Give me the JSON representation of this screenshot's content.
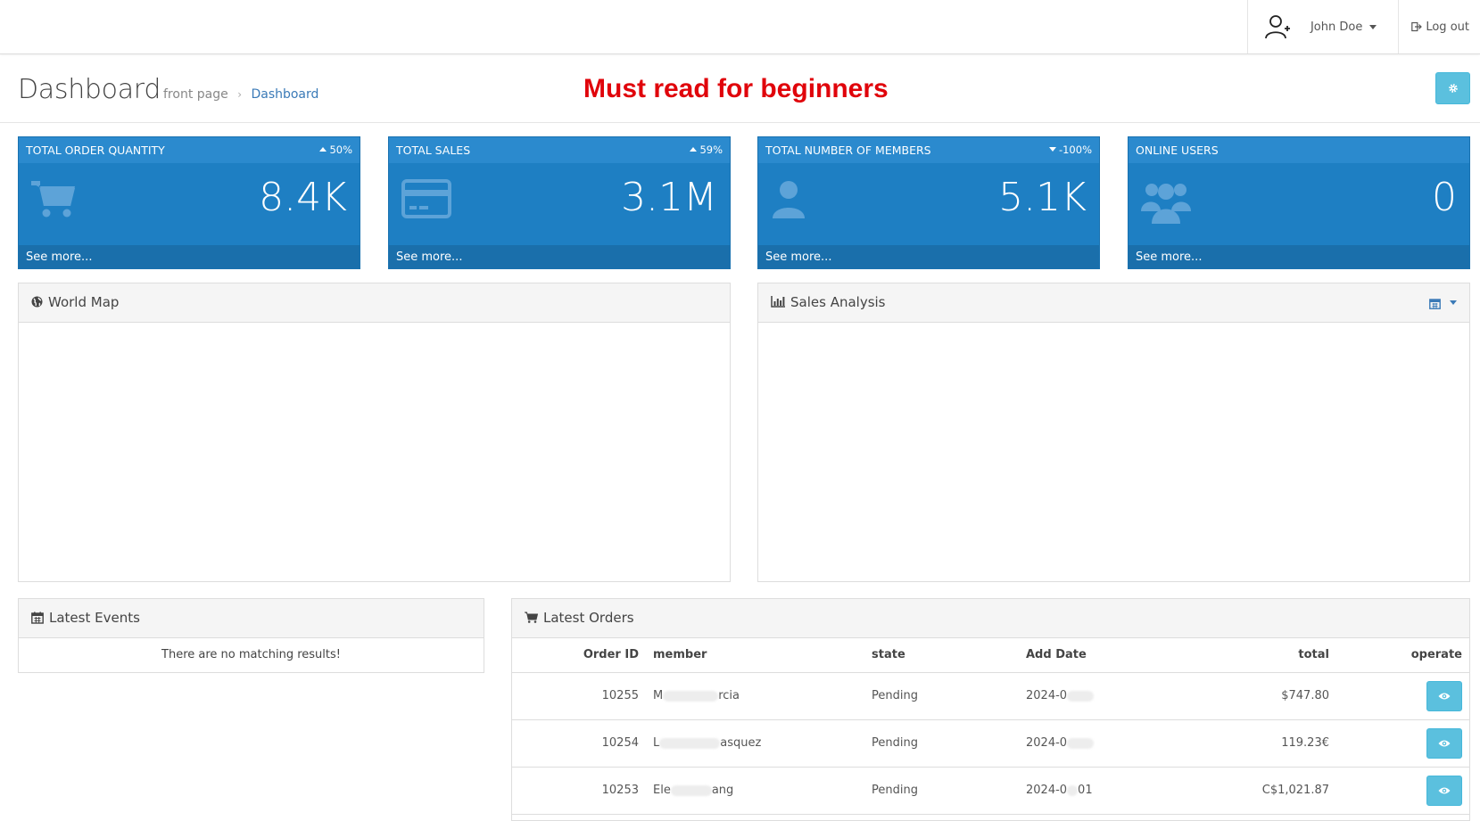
{
  "navbar": {
    "user_name": "John Doe",
    "logout_label": "Log out"
  },
  "header": {
    "title": "Dashboard",
    "breadcrumb": [
      "front page",
      "Dashboard"
    ],
    "promo": "Must read for beginners"
  },
  "tiles": [
    {
      "label": "TOTAL ORDER QUANTITY",
      "change": "50%",
      "trend": "up",
      "value": "8.4K",
      "icon": "shopping-cart-icon",
      "more": "See more..."
    },
    {
      "label": "TOTAL SALES",
      "change": "59%",
      "trend": "up",
      "value": "3.1M",
      "icon": "credit-card-icon",
      "more": "See more..."
    },
    {
      "label": "TOTAL NUMBER OF MEMBERS",
      "change": "-100%",
      "trend": "down",
      "value": "5.1K",
      "icon": "user-icon",
      "more": "See more..."
    },
    {
      "label": "ONLINE USERS",
      "change": "",
      "trend": "",
      "value": "0",
      "icon": "users-icon",
      "more": "See more..."
    }
  ],
  "world_map": {
    "title": "World Map"
  },
  "sales_analysis": {
    "title": "Sales Analysis"
  },
  "latest_events": {
    "title": "Latest Events",
    "empty": "There are no matching results!"
  },
  "latest_orders": {
    "title": "Latest Orders",
    "columns": [
      "Order ID",
      "member",
      "state",
      "Add Date",
      "total",
      "operate"
    ],
    "rows": [
      {
        "id": "10255",
        "member_start": "M",
        "member_end": "rcia",
        "state": "Pending",
        "date": "2024-0",
        "total": "$747.80"
      },
      {
        "id": "10254",
        "member_start": "L",
        "member_end": "asquez",
        "state": "Pending",
        "date": "2024-0",
        "total": "119.23€"
      },
      {
        "id": "10253",
        "member_start": "Ele",
        "member_end": "ang",
        "state": "Pending",
        "date": "2024-0",
        "date_end": "01",
        "total": "C$1,021.87"
      }
    ]
  },
  "colors": {
    "tile_bg": "#1e7fc3",
    "info_button": "#5bc0de",
    "promo": "#e0040b",
    "link": "#3a7ab7"
  }
}
